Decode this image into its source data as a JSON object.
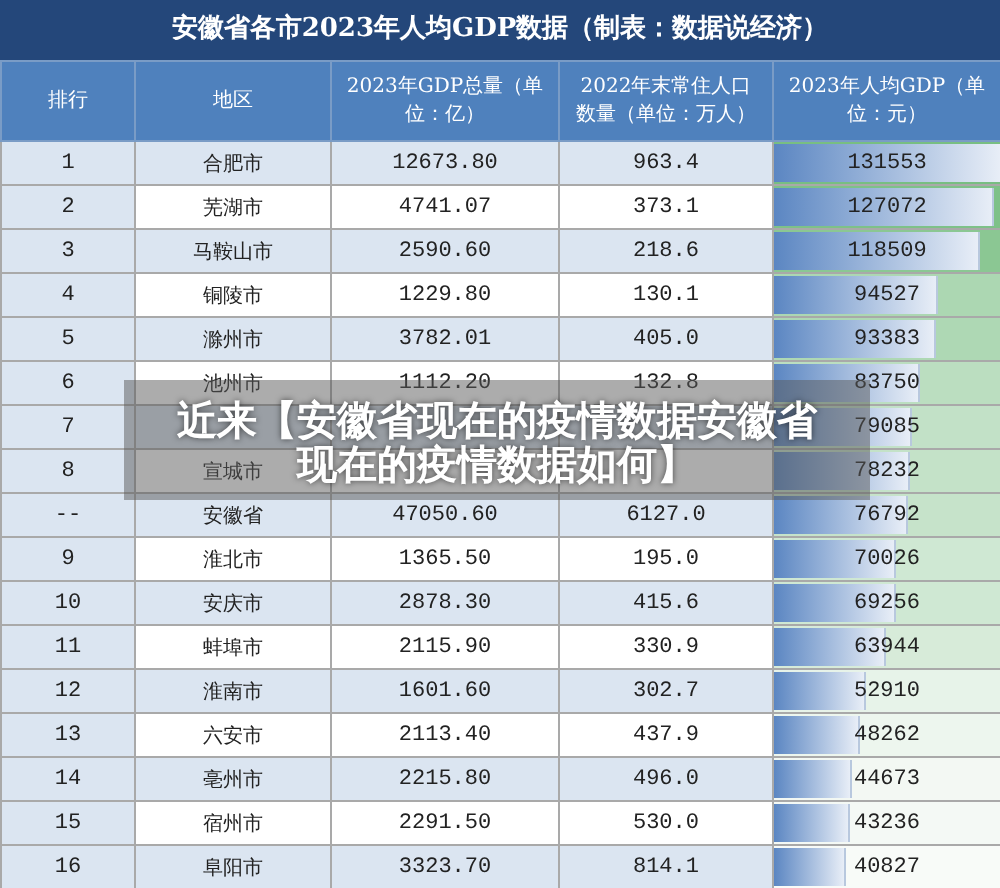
{
  "title": "安徽省各市2023年人均GDP数据（制表：数据说经济）",
  "columns": [
    "排行",
    "地区",
    "2023年GDP总量（单位：亿）",
    "2022年末常住人口数量（单位：万人）",
    "2023年人均GDP（单位：元）"
  ],
  "rows": [
    {
      "rank": "1",
      "city": "合肥市",
      "gdp": "12673.80",
      "population": "963.4",
      "per_capita": "131553",
      "level": 1.0
    },
    {
      "rank": "2",
      "city": "芜湖市",
      "gdp": "4741.07",
      "population": "373.1",
      "per_capita": "127072",
      "level": 0.966
    },
    {
      "rank": "3",
      "city": "马鞍山市",
      "gdp": "2590.60",
      "population": "218.6",
      "per_capita": "118509",
      "level": 0.9
    },
    {
      "rank": "4",
      "city": "铜陵市",
      "gdp": "1229.80",
      "population": "130.1",
      "per_capita": "94527",
      "level": 0.72
    },
    {
      "rank": "5",
      "city": "滁州市",
      "gdp": "3782.01",
      "population": "405.0",
      "per_capita": "93383",
      "level": 0.71
    },
    {
      "rank": "6",
      "city": "池州市",
      "gdp": "1112.20",
      "population": "132.8",
      "per_capita": "83750",
      "level": 0.64
    },
    {
      "rank": "7",
      "per_capita": "79085",
      "level": 0.6
    },
    {
      "rank": "8",
      "city": "宣城市",
      "per_capita": "78232",
      "level": 0.59
    },
    {
      "rank": "--",
      "city": "安徽省",
      "gdp": "47050.60",
      "population": "6127.0",
      "per_capita": "76792",
      "level": 0.58
    },
    {
      "rank": "9",
      "city": "淮北市",
      "gdp": "1365.50",
      "population": "195.0",
      "per_capita": "70026",
      "level": 0.53
    },
    {
      "rank": "10",
      "city": "安庆市",
      "gdp": "2878.30",
      "population": "415.6",
      "per_capita": "69256",
      "level": 0.53
    },
    {
      "rank": "11",
      "city": "蚌埠市",
      "gdp": "2115.90",
      "population": "330.9",
      "per_capita": "63944",
      "level": 0.49
    },
    {
      "rank": "12",
      "city": "淮南市",
      "gdp": "1601.60",
      "population": "302.7",
      "per_capita": "52910",
      "level": 0.4
    },
    {
      "rank": "13",
      "city": "六安市",
      "gdp": "2113.40",
      "population": "437.9",
      "per_capita": "48262",
      "level": 0.37
    },
    {
      "rank": "14",
      "city": "亳州市",
      "gdp": "2215.80",
      "population": "496.0",
      "per_capita": "44673",
      "level": 0.34
    },
    {
      "rank": "15",
      "city": "宿州市",
      "gdp": "2291.50",
      "population": "530.0",
      "per_capita": "43236",
      "level": 0.33
    },
    {
      "rank": "16",
      "city": "阜阳市",
      "gdp": "3323.70",
      "population": "814.1",
      "per_capita": "40827",
      "level": 0.31
    }
  ],
  "overlay_caption": "近来【安徽省现在的疫情数据安徽省现在的疫情数据如何】"
}
